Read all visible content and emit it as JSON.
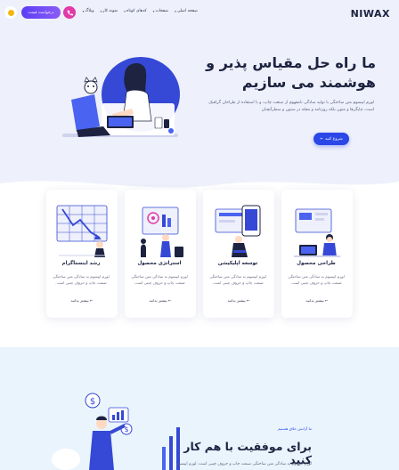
{
  "header": {
    "logo": "NIWAX",
    "nav": [
      {
        "label": "صفحه اصلی"
      },
      {
        "label": "صفحات"
      },
      {
        "label": "کدهای کوتاه"
      },
      {
        "label": "نمونه کار"
      },
      {
        "label": "وبلاگ"
      }
    ],
    "quote_label": "درخواست قیمت"
  },
  "hero": {
    "title": "ما راه حل مقیاس پذیر و هوشمند می سازیم",
    "text": "لورم ایپسوم متن ساختگی با تولید سادگی نامفهوم از صنعت چاپ، و با استفاده از طراحان گرافیک است، چاپگرها و متون بلکه روزنامه و مجله در ستون و سطرآنچنان",
    "button_label": "شروع کنید"
  },
  "services": [
    {
      "title": "طراحی محصول",
      "text": "لورم ایپسوم به سادگی متن ساختگی صنعت چاپ و حروف چینی است.",
      "link": "بیشتر بدانید"
    },
    {
      "title": "توسعه اپلیکیشن",
      "text": "لورم ایپسوم به سادگی متن ساختگی صنعت چاپ و حروف چینی است.",
      "link": "بیشتر بدانید"
    },
    {
      "title": "استراتژی محصول",
      "text": "لورم ایپسوم به سادگی متن ساختگی صنعت چاپ و حروف چینی است.",
      "link": "بیشتر بدانید"
    },
    {
      "title": "رشد اینستاگرام",
      "text": "لورم ایپسوم به سادگی متن ساختگی صنعت چاپ و حروف چینی است.",
      "link": "بیشتر بدانید"
    }
  ],
  "about": {
    "tag": "ما آژانس خلاق هستیم",
    "title": "برای موفقیت با هم کار کنید",
    "text": "لورم ایپسوم به سادگی متن ساختگی صنعت چاپ و حروف چینی است. لورم ایپسوم"
  },
  "colors": {
    "accent": "#2b47e8",
    "quote_gradient_start": "#5b3df5",
    "quote_gradient_end": "#8a5cf6",
    "phone": "#e23aa8",
    "hero_bg": "#eef0fb",
    "bottom_bg": "#eaf4fd"
  },
  "icons": {
    "phone": "phone-icon",
    "language": "language-icon",
    "arrow": "arrow-left-icon"
  }
}
